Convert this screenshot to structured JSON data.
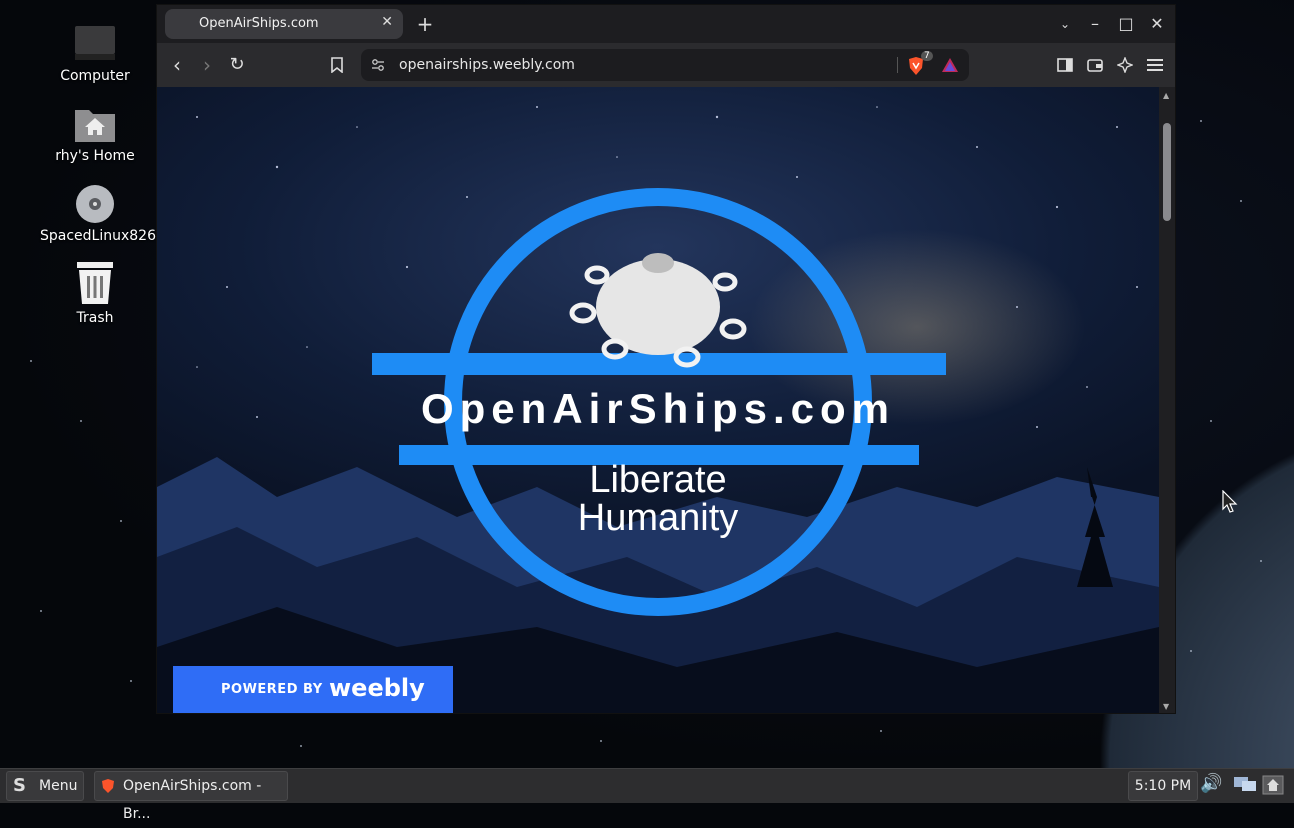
{
  "desktop": {
    "icons": [
      {
        "label": "Computer"
      },
      {
        "label": "rhy's Home"
      },
      {
        "label": "SpacedLinux826"
      },
      {
        "label": "Trash"
      }
    ]
  },
  "browser": {
    "tab_title": "OpenAirShips.com",
    "address": "openairships.weebly.com",
    "shield_count": "7"
  },
  "page": {
    "site_name": "OpenAirShips.com",
    "tagline_line1": "Liberate",
    "tagline_line2": "Humanity",
    "powered_by": "POWERED BY",
    "weebly": "weebly"
  },
  "taskbar": {
    "menu_label": "Menu",
    "window_label": "OpenAirShips.com - Br...",
    "clock": "5:10 PM"
  },
  "colors": {
    "logo_blue": "#1e8cf5",
    "weebly_blue": "#2f6df6",
    "brave_orange": "#fb542b"
  }
}
